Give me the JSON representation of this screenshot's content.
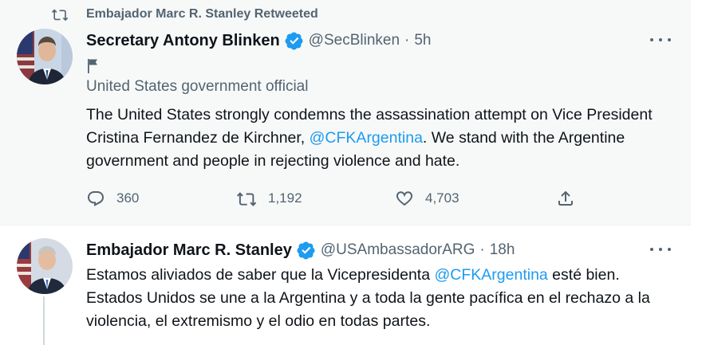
{
  "retweet_banner": {
    "text": "Embajador Marc R. Stanley Retweeted"
  },
  "tweet1": {
    "name": "Secretary Antony Blinken",
    "handle": "@SecBlinken",
    "separator": "·",
    "time": "5h",
    "label": "United States government official",
    "text_before": "The United States strongly condemns the assassination attempt on Vice President Cristina Fernandez de Kirchner, ",
    "mention": "@CFKArgentina",
    "text_after": ". We stand with the Argentine government and people in rejecting violence and hate.",
    "replies": "360",
    "retweets": "1,192",
    "likes": "4,703"
  },
  "tweet2": {
    "name": "Embajador Marc R. Stanley",
    "handle": "@USAmbassadorARG",
    "separator": "·",
    "time": "18h",
    "text_before": "Estamos aliviados de saber que la Vicepresidenta ",
    "mention": "@CFKArgentina",
    "text_after": " esté bien. Estados Unidos se une a la Argentina y a toda la gente pacífica en el rechazo a la violencia, el extremismo y el odio en todas partes."
  },
  "colors": {
    "accent": "#1d9bf0",
    "secondary_text": "#536471",
    "primary_text": "#0f1419",
    "highlight_bg": "#f7f9f9"
  },
  "icons": [
    "retweet-icon",
    "verified-badge-icon",
    "more-icon",
    "flag-icon",
    "reply-icon",
    "like-icon",
    "share-icon"
  ]
}
